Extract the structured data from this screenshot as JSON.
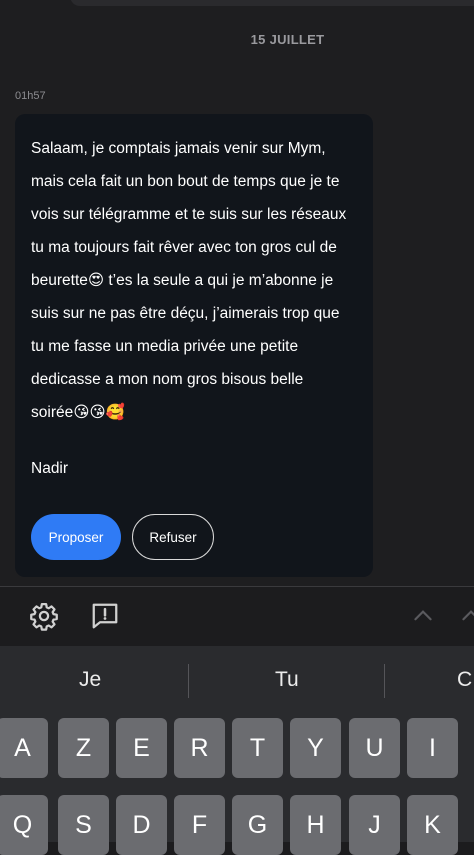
{
  "chat": {
    "date_separator": "15 JUILLET",
    "message_time": "01h57",
    "message_lines": [
      "Salaam, je comptais jamais venir sur Mym,",
      "mais cela fait un bon bout de temps que je te",
      "vois sur télégramme et te suis sur les réseaux",
      "tu ma toujours fait rêver avec ton gros cul de",
      "beurette😍 t’es la seule a qui je m’abonne je",
      "suis sur ne pas être déçu, j’aimerais trop que",
      "tu me fasse un media privée une petite",
      "dedicasse a mon nom gros bisous belle",
      "soirée😘😘🥰"
    ],
    "signature": "Nadir",
    "propose_label": "Proposer",
    "refuse_label": "Refuser"
  },
  "toolbar": {
    "icons": [
      "gear-icon",
      "report-icon",
      "chevron-up-icon",
      "chevron-up-icon"
    ]
  },
  "keyboard": {
    "suggestions": [
      "Je",
      "Tu",
      "C"
    ],
    "row1": [
      "A",
      "Z",
      "E",
      "R",
      "T",
      "Y",
      "U",
      "I"
    ],
    "row2": [
      "Q",
      "S",
      "D",
      "F",
      "G",
      "H",
      "J",
      "K"
    ]
  },
  "colors": {
    "chat_background": "#1e1e20",
    "bubble_background": "#11151b",
    "primary_button": "#2f7bf5",
    "keyboard_background": "#2a2b2e",
    "key_background": "#6b6c70"
  }
}
